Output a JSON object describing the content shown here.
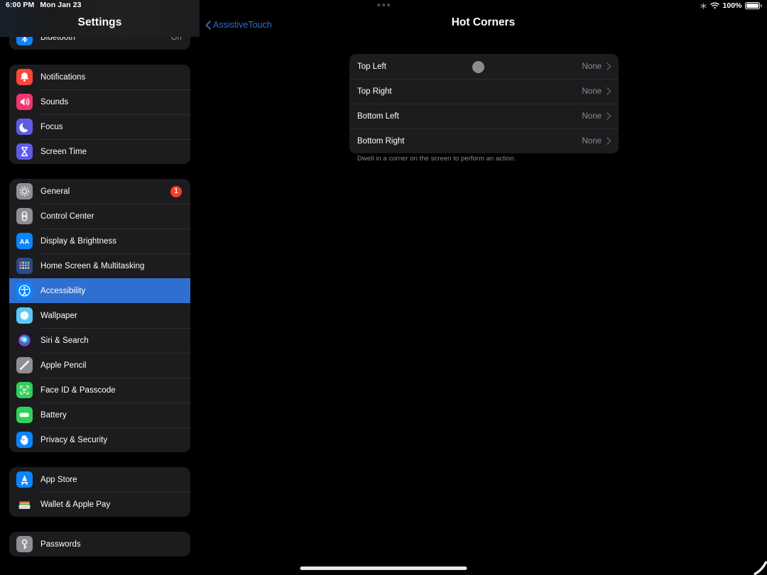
{
  "status_bar": {
    "time": "6:00 PM",
    "date": "Mon Jan 23",
    "bluetooth_icon": "asterisk-icon",
    "wifi_icon": "wifi-icon",
    "battery_percent": "100%",
    "battery_icon": "battery-full-icon",
    "multitask_dots_icon": "multitasking-dots-icon"
  },
  "sidebar": {
    "title": "Settings",
    "groups": [
      {
        "items": [
          {
            "label": "Bluetooth",
            "value": "On",
            "icon": "bluetooth-icon",
            "icon_color": "#0a84ff",
            "selected": false
          }
        ]
      },
      {
        "items": [
          {
            "label": "Notifications",
            "value": "",
            "icon": "bell-icon",
            "icon_color": "#ff453a",
            "selected": false
          },
          {
            "label": "Sounds",
            "value": "",
            "icon": "speaker-icon",
            "icon_color": "#f3356d",
            "selected": false
          },
          {
            "label": "Focus",
            "value": "",
            "icon": "moon-icon",
            "icon_color": "#5e5ce6",
            "selected": false
          },
          {
            "label": "Screen Time",
            "value": "",
            "icon": "hourglass-icon",
            "icon_color": "#5e5ce6",
            "selected": false
          }
        ]
      },
      {
        "items": [
          {
            "label": "General",
            "value": "",
            "badge": "1",
            "icon": "gear-icon",
            "icon_color": "#8e8e93",
            "selected": false
          },
          {
            "label": "Control Center",
            "value": "",
            "icon": "toggles-icon",
            "icon_color": "#8e8e93",
            "selected": false
          },
          {
            "label": "Display & Brightness",
            "value": "",
            "icon": "text-size-icon",
            "icon_color": "#0a84ff",
            "selected": false
          },
          {
            "label": "Home Screen & Multitasking",
            "value": "",
            "icon": "app-grid-icon",
            "icon_color": "#2b4a8b",
            "selected": false
          },
          {
            "label": "Accessibility",
            "value": "",
            "icon": "accessibility-icon",
            "icon_color": "#0a84ff",
            "selected": true
          },
          {
            "label": "Wallpaper",
            "value": "",
            "icon": "flower-icon",
            "icon_color": "#5ac8f5",
            "selected": false
          },
          {
            "label": "Siri & Search",
            "value": "",
            "icon": "siri-icon",
            "icon_color": "#3a2a4a",
            "selected": false
          },
          {
            "label": "Apple Pencil",
            "value": "",
            "icon": "pencil-icon",
            "icon_color": "#8e8e93",
            "selected": false
          },
          {
            "label": "Face ID & Passcode",
            "value": "",
            "icon": "face-id-icon",
            "icon_color": "#30d158",
            "selected": false
          },
          {
            "label": "Battery",
            "value": "",
            "icon": "battery-icon",
            "icon_color": "#30d158",
            "selected": false
          },
          {
            "label": "Privacy & Security",
            "value": "",
            "icon": "hand-raised-icon",
            "icon_color": "#0a84ff",
            "selected": false
          }
        ]
      },
      {
        "items": [
          {
            "label": "App Store",
            "value": "",
            "icon": "app-store-icon",
            "icon_color": "#0a84ff",
            "selected": false
          },
          {
            "label": "Wallet & Apple Pay",
            "value": "",
            "icon": "wallet-icon",
            "icon_color": "#1c1c1e",
            "selected": false
          }
        ]
      },
      {
        "items": [
          {
            "label": "Passwords",
            "value": "",
            "icon": "key-icon",
            "icon_color": "#8e8e93",
            "selected": false
          }
        ]
      }
    ]
  },
  "detail": {
    "back_label": "AssistiveTouch",
    "back_icon": "chevron-left-icon",
    "title": "Hot Corners",
    "rows": [
      {
        "label": "Top Left",
        "value": "None",
        "chevron": "chevron-right-icon"
      },
      {
        "label": "Top Right",
        "value": "None",
        "chevron": "chevron-right-icon"
      },
      {
        "label": "Bottom Left",
        "value": "None",
        "chevron": "chevron-right-icon"
      },
      {
        "label": "Bottom Right",
        "value": "None",
        "chevron": "chevron-right-icon"
      }
    ],
    "footer": "Dwell in a corner on the screen to perform an action."
  },
  "overlays": {
    "pointer_icon": "assistive-touch-pointer",
    "home_indicator_icon": "home-indicator"
  },
  "colors": {
    "accent_blue": "#2f6fd0",
    "card_bg": "#1c1c1e",
    "secondary_text": "#8e8e93",
    "badge_red": "#ff3b30"
  }
}
